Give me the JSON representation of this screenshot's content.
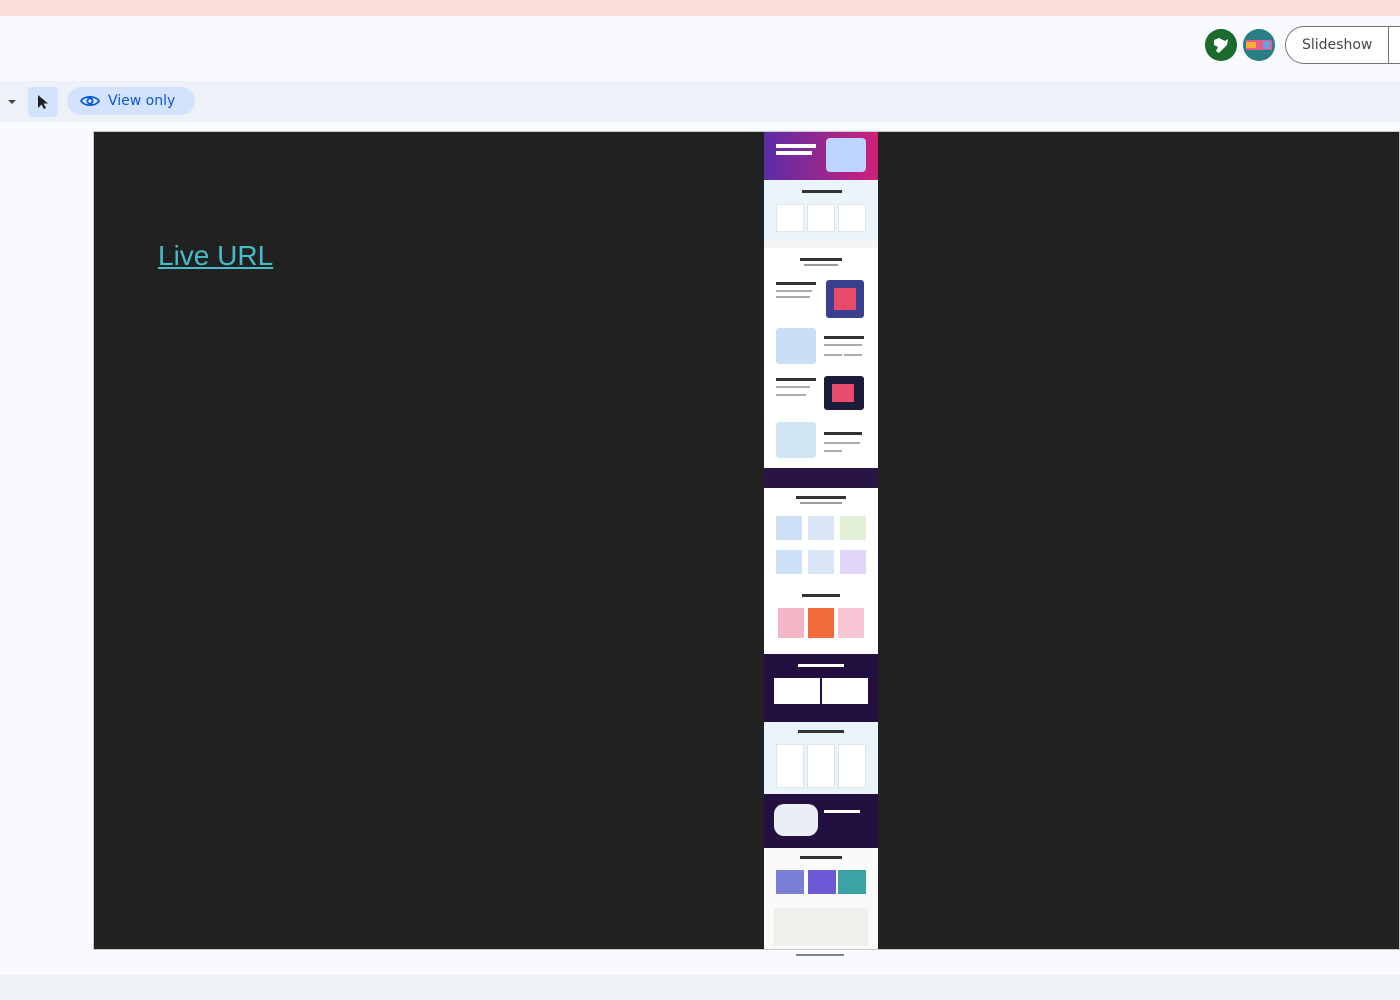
{
  "header": {
    "slideshow_label": "Slideshow"
  },
  "toolbar": {
    "view_only_label": "View only"
  },
  "slide": {
    "link_text": "Live URL"
  },
  "colors": {
    "banner": "#fcdcd9",
    "slide_background": "#212121",
    "link": "#46bdc6",
    "view_only_text": "#0b57d0"
  },
  "icons": {
    "avatar_1": "avatar-icon",
    "avatar_2": "avatar-icon",
    "cursor": "cursor-icon",
    "view_only": "eye-icon"
  }
}
